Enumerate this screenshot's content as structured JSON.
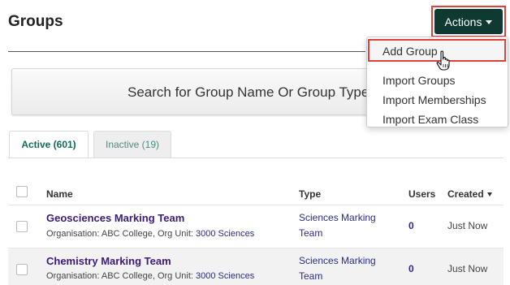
{
  "page": {
    "title": "Groups"
  },
  "actions": {
    "label": "Actions",
    "caret_icon": "caret-down-icon"
  },
  "menu": {
    "items": [
      {
        "label": "Add Group"
      },
      {
        "label": "Import Groups"
      },
      {
        "label": "Import Memberships"
      },
      {
        "label": "Import Exam Class"
      }
    ]
  },
  "search": {
    "placeholder": "Search for Group Name Or Group Type"
  },
  "tabs": [
    {
      "label": "Active (601)",
      "active": true
    },
    {
      "label": "Inactive (19)",
      "active": false
    }
  ],
  "table": {
    "headers": {
      "name": "Name",
      "type": "Type",
      "users": "Users",
      "created": "Created"
    },
    "rows": [
      {
        "name": "Geosciences Marking Team",
        "org_prefix": "Organisation: ABC College, Org Unit: ",
        "org_unit": "3000 Sciences",
        "type_line1": "Sciences Marking",
        "type_line2": "Team",
        "users": "0",
        "created": "Just Now"
      },
      {
        "name": "Chemistry Marking Team",
        "org_prefix": "Organisation: ABC College, Org Unit: ",
        "org_unit": "3000 Sciences",
        "type_line1": "Sciences Marking",
        "type_line2": "Team",
        "users": "0",
        "created": "Just Now"
      }
    ]
  },
  "colors": {
    "actions_bg": "#0f3a31",
    "highlight_outline": "#e0403a",
    "active_tab_text": "#0f6b5b",
    "group_name": "#3a1a7a"
  }
}
